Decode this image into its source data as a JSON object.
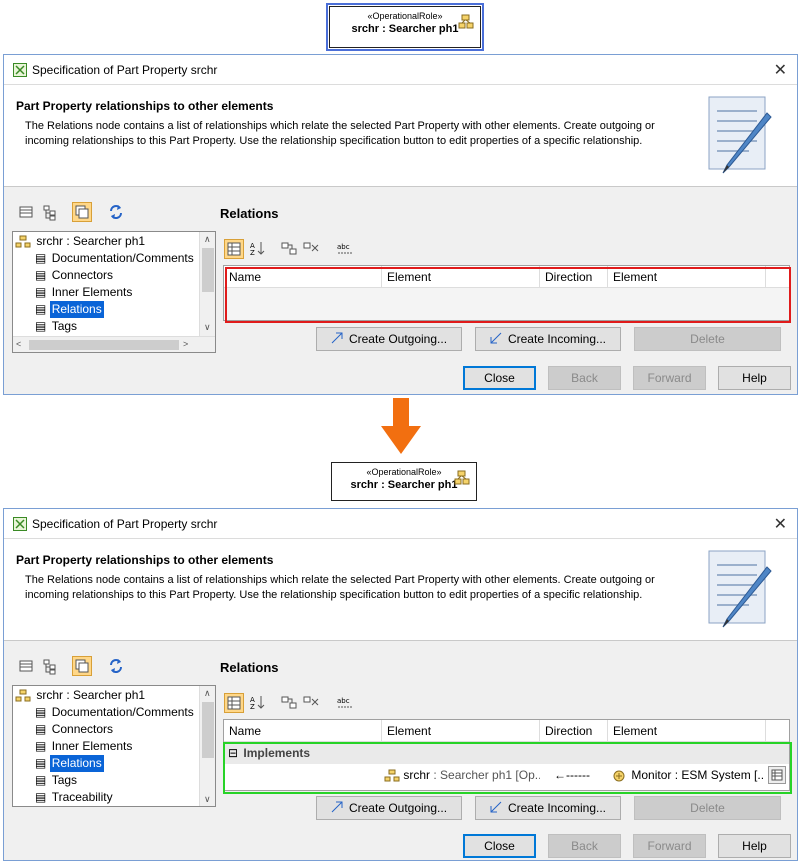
{
  "before": {
    "role_box": {
      "stereotype": "«OperationalRole»",
      "name": "srchr : Searcher ph1"
    },
    "dialog": {
      "title": "Specification of Part Property srchr",
      "close_glyph": "✕",
      "info_heading": "Part Property relationships to other elements",
      "info_text": "The Relations node contains a list of relationships which relate the selected Part Property with other elements. Create outgoing or incoming relationships to this Part Property. Use the relationship specification button to edit properties of a specific relationship.",
      "tree": {
        "root": "srchr : Searcher ph1",
        "items": [
          "Documentation/Comments",
          "Connectors",
          "Inner Elements",
          "Relations",
          "Tags"
        ],
        "selected": "Relations"
      },
      "section_title": "Relations",
      "columns": [
        "Name",
        "Element",
        "Direction",
        "Element"
      ],
      "buttons": {
        "create_outgoing": "Create Outgoing...",
        "create_incoming": "Create Incoming...",
        "delete": "Delete"
      },
      "footer": {
        "close": "Close",
        "back": "Back",
        "forward": "Forward",
        "help": "Help"
      }
    }
  },
  "after": {
    "role_box": {
      "stereotype": "«OperationalRole»",
      "name": "srchr : Searcher ph1"
    },
    "dialog": {
      "title": "Specification of Part Property srchr",
      "close_glyph": "✕",
      "info_heading": "Part Property relationships to other elements",
      "info_text": "The Relations node contains a list of relationships which relate the selected Part Property with other elements. Create outgoing or incoming relationships to this Part Property. Use the relationship specification button to edit properties of a specific relationship.",
      "tree": {
        "root": "srchr : Searcher ph1",
        "items": [
          "Documentation/Comments",
          "Connectors",
          "Inner Elements",
          "Relations",
          "Tags",
          "Traceability"
        ],
        "selected": "Relations"
      },
      "section_title": "Relations",
      "columns": [
        "Name",
        "Element",
        "Direction",
        "Element"
      ],
      "group": {
        "toggle": "⊟",
        "label": "Implements"
      },
      "row": {
        "source_name": "srchr",
        "source_type": " : Searcher ph1 [Op...",
        "direction": "←------",
        "target": "Monitor : ESM System [..."
      },
      "buttons": {
        "create_outgoing": "Create Outgoing...",
        "create_incoming": "Create Incoming...",
        "delete": "Delete"
      },
      "footer": {
        "close": "Close",
        "back": "Back",
        "forward": "Forward",
        "help": "Help"
      }
    }
  },
  "colors": {
    "highlight_before": "#e01b1b",
    "highlight_after": "#27d327",
    "transition_arrow": "#f26f10",
    "selection": "#0a64d7"
  }
}
